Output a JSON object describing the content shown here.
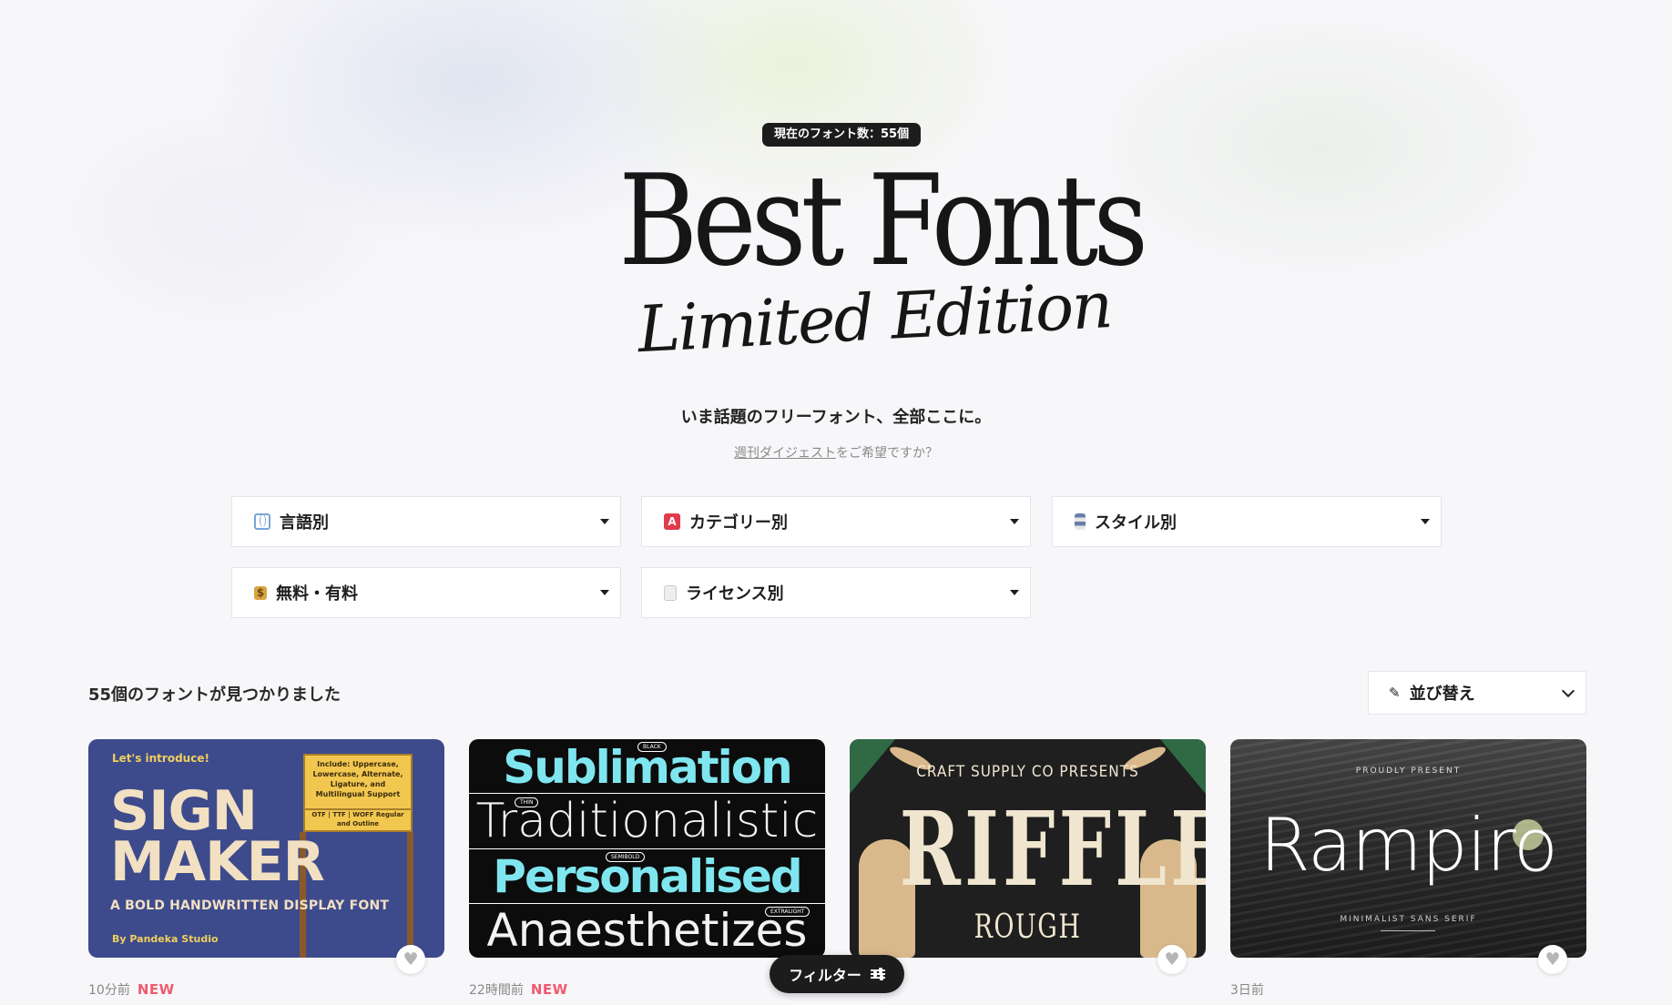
{
  "header": {
    "font_count_badge": "現在のフォント数：55個",
    "title": "Best Fonts",
    "subtitle": "Limited Edition",
    "tagline": "いま話題のフリーフォント、全部ここに。",
    "digest_link": "週刊ダイジェスト",
    "digest_suffix": "をご希望ですか？"
  },
  "filters": [
    {
      "label": "言語別",
      "icon": "globe-icon"
    },
    {
      "label": "カテゴリー別",
      "icon": "letter-a-icon"
    },
    {
      "label": "スタイル別",
      "icon": "style-icon"
    },
    {
      "label": "無料・有料",
      "icon": "money-bag-icon"
    },
    {
      "label": "ライセンス別",
      "icon": "document-icon"
    }
  ],
  "results": {
    "count_text": "55個のフォントが見つかりました",
    "sort_label": "並び替え"
  },
  "cards": [
    {
      "time": "10分前",
      "new_badge": "NEW",
      "preview": {
        "intro": "Let's introduce!",
        "line1": "SIGN",
        "line2": "MAKER",
        "tagline": "A BOLD HANDWRITTEN DISPLAY FONT",
        "by": "By Pandeka Studio",
        "sign_text": "Include: Uppercase, Lowercase, Alternate, Ligature, and Multilingual Support",
        "sign_text2": "OTF | TTF | WOFF Regular and Outline"
      }
    },
    {
      "time": "22時間前",
      "new_badge": "NEW",
      "preview": {
        "w1": "Sublimation",
        "w2": "Traditionalistic",
        "w3": "Personalised",
        "w4": "Anaesthetizes",
        "tag1": "BLACK",
        "tag2": "THIN",
        "tag3": "SEMIBOLD",
        "tag4": "EXTRALIGHT"
      }
    },
    {
      "time": "",
      "new_badge": "",
      "preview": {
        "presents": "CRAFT SUPPLY CO PRESENTS",
        "name": "RIFFLE",
        "sub": "ROUGH"
      }
    },
    {
      "time": "3日前",
      "new_badge": "",
      "preview": {
        "proudly": "PROUDLY PRESENT",
        "name": "Rampiro",
        "sub": "MINIMALIST SANS SERIF"
      }
    }
  ],
  "floating": {
    "filter_button": "フィルター"
  }
}
